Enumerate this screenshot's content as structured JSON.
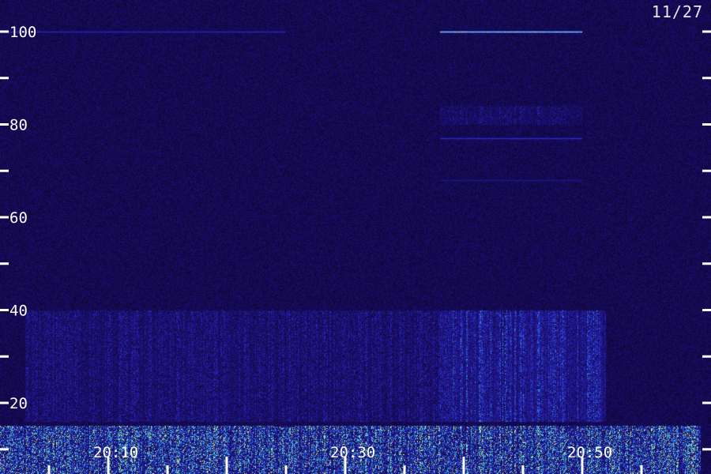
{
  "date_label": "11/27",
  "colors": {
    "background": "#12063a",
    "noise_low": "#1a0f6e",
    "noise_mid": "#2c2fd6",
    "signal_high": "#33e0e8",
    "signal_peak": "#f4f46a",
    "ticks": "#ffffff"
  },
  "chart_data": {
    "type": "heatmap",
    "title": "",
    "xlabel": "",
    "ylabel": "",
    "xlim": [
      "20:00",
      "21:00"
    ],
    "ylim": [
      0,
      103
    ],
    "x_ticks": [
      "20:10",
      "20:30",
      "20:50"
    ],
    "y_ticks": [
      20,
      40,
      60,
      80,
      100
    ],
    "grid": false,
    "features": [
      {
        "kind": "tone",
        "freq": 100,
        "start": "20:00",
        "end": "20:25",
        "level": 0.55
      },
      {
        "kind": "tone",
        "freq": 100,
        "start": "20:38",
        "end": "20:50",
        "level": 1.0
      },
      {
        "kind": "tone",
        "freq": 77,
        "start": "20:38",
        "end": "20:50",
        "level": 0.6
      },
      {
        "kind": "tone",
        "freq": 68,
        "start": "20:38",
        "end": "20:50",
        "level": 0.4
      },
      {
        "kind": "band",
        "freq_low": 80,
        "freq_high": 84,
        "start": "20:38",
        "end": "20:50",
        "level": 0.3
      },
      {
        "kind": "band",
        "freq_low": 16,
        "freq_high": 40,
        "start": "20:03",
        "end": "20:52",
        "level": 0.35
      },
      {
        "kind": "band",
        "freq_low": 16,
        "freq_high": 40,
        "start": "20:38",
        "end": "20:52",
        "level": 0.45
      },
      {
        "kind": "band",
        "freq_low": 0,
        "freq_high": 15,
        "start": "20:00",
        "end": "21:00",
        "level": 0.6
      }
    ]
  }
}
